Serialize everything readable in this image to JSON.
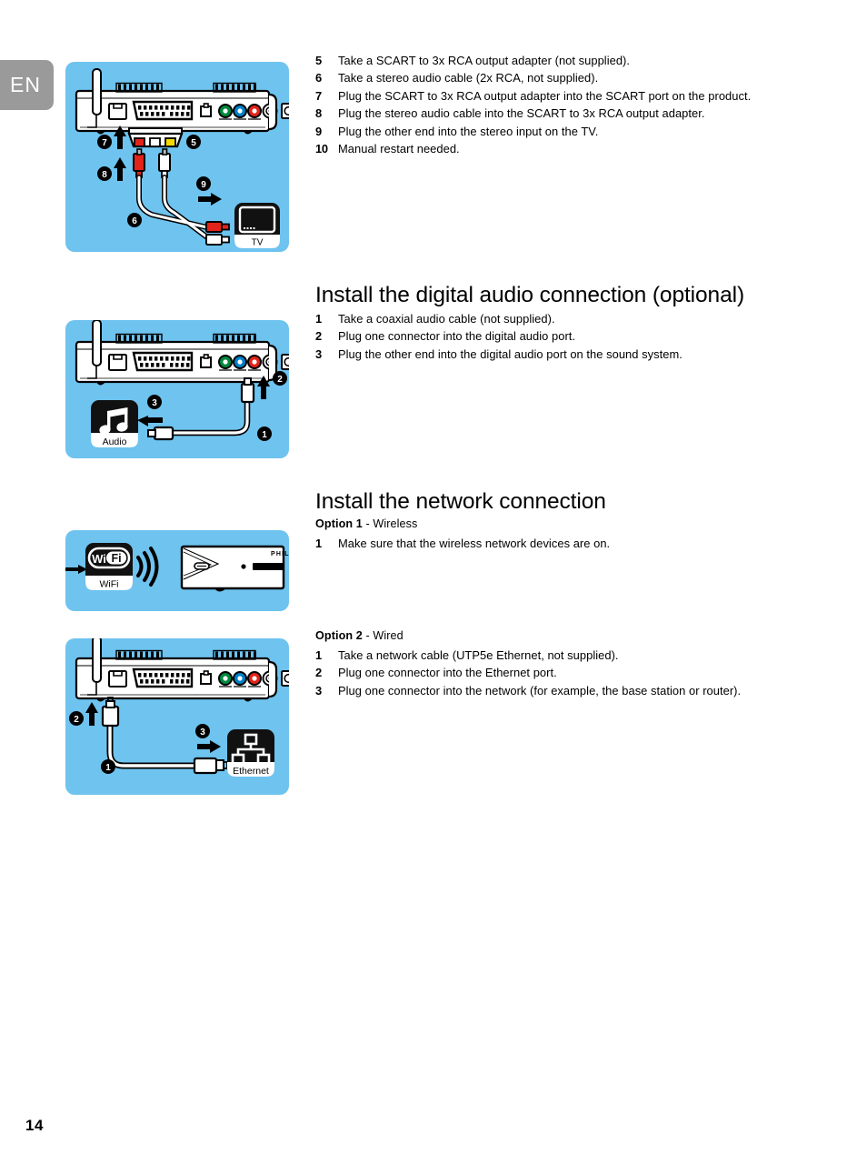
{
  "language_tab": {
    "label": "EN"
  },
  "page_number": "14",
  "sections": {
    "scart": {
      "steps": [
        {
          "num": "5",
          "text": "Take a SCART to 3x RCA output adapter (not supplied)."
        },
        {
          "num": "6",
          "text": "Take a stereo audio cable (2x RCA, not supplied)."
        },
        {
          "num": "7",
          "text": "Plug the SCART to 3x RCA output adapter into the SCART port on the product."
        },
        {
          "num": "8",
          "text": "Plug the stereo audio cable into the SCART to 3x RCA output adapter."
        },
        {
          "num": "9",
          "text": "Plug the other end into the stereo input on the TV."
        },
        {
          "num": "10",
          "text": "Manual restart needed."
        }
      ],
      "diagram": {
        "callouts": [
          "7",
          "5",
          "8",
          "9",
          "6"
        ],
        "device_label": "",
        "target_icon_label": "TV",
        "target_icon_name": "tv-icon"
      }
    },
    "digital_audio": {
      "heading": "Install the digital audio connection (optional)",
      "steps": [
        {
          "num": "1",
          "text": "Take a coaxial audio cable (not supplied)."
        },
        {
          "num": "2",
          "text": "Plug one connector into the digital audio port."
        },
        {
          "num": "3",
          "text": "Plug the other end into the digital audio port on the sound system."
        }
      ],
      "diagram": {
        "callouts": [
          "3",
          "2",
          "1"
        ],
        "target_icon_label": "Audio",
        "target_icon_name": "music-note-icon"
      }
    },
    "network": {
      "heading": "Install the network connection",
      "option1": {
        "bold": "Option 1",
        "rest": " - Wireless"
      },
      "option1_steps": [
        {
          "num": "1",
          "text": "Make sure that the wireless network devices are on."
        }
      ],
      "option1_diagram": {
        "target_icon_label": "WiFi",
        "target_icon_name": "wifi-icon",
        "logo_text_left": "Wi",
        "logo_text_right": "Fi",
        "brand_text": "PHILIPS"
      },
      "option2": {
        "bold": "Option 2",
        "rest": " - Wired"
      },
      "option2_steps": [
        {
          "num": "1",
          "text": "Take a network cable (UTP5e Ethernet, not supplied)."
        },
        {
          "num": "2",
          "text": "Plug one connector into the Ethernet port."
        },
        {
          "num": "3",
          "text": "Plug one connector into the network (for example, the base station or router)."
        }
      ],
      "option2_diagram": {
        "callouts": [
          "2",
          "3",
          "1"
        ],
        "target_icon_label": "Ethernet",
        "target_icon_name": "network-topology-icon"
      }
    }
  },
  "colors": {
    "panel_background": "#6ec3ef",
    "language_tab": "#9a9a9a",
    "rca_red": "#e2231a",
    "rca_white": "#ffffff",
    "rca_yellow": "#f5d800",
    "component_green": "#00883e",
    "component_blue": "#0080c8",
    "component_red": "#e2231a",
    "ink": "#000000"
  }
}
